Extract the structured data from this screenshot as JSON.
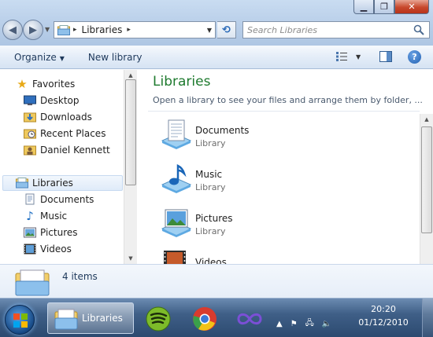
{
  "window": {
    "caption_buttons": [
      "minimize",
      "maximize",
      "close"
    ]
  },
  "address_bar": {
    "path_segments": [
      "Libraries"
    ],
    "refresh_icon": "refresh-icon"
  },
  "search": {
    "placeholder": "Search Libraries",
    "value": ""
  },
  "toolbar": {
    "organize_label": "Organize",
    "new_library_label": "New library",
    "views_icon": "details-view-icon",
    "preview_icon": "preview-pane-icon",
    "help_label": "?"
  },
  "nav": {
    "favorites": {
      "label": "Favorites",
      "items": [
        {
          "label": "Desktop",
          "icon": "desktop-icon"
        },
        {
          "label": "Downloads",
          "icon": "downloads-folder-icon"
        },
        {
          "label": "Recent Places",
          "icon": "recent-places-icon"
        },
        {
          "label": "Daniel Kennett",
          "icon": "user-folder-icon"
        }
      ]
    },
    "libraries": {
      "label": "Libraries",
      "selected": true,
      "items": [
        {
          "label": "Documents",
          "icon": "documents-icon"
        },
        {
          "label": "Music",
          "icon": "music-icon"
        },
        {
          "label": "Pictures",
          "icon": "pictures-icon"
        },
        {
          "label": "Videos",
          "icon": "videos-icon"
        }
      ]
    }
  },
  "content": {
    "title": "Libraries",
    "subtitle": "Open a library to see your files and arrange them by folder, ...",
    "libraries": [
      {
        "name": "Documents",
        "kind": "Library",
        "icon": "documents-library-icon"
      },
      {
        "name": "Music",
        "kind": "Library",
        "icon": "music-library-icon"
      },
      {
        "name": "Pictures",
        "kind": "Library",
        "icon": "pictures-library-icon"
      },
      {
        "name": "Videos",
        "kind": "",
        "icon": "videos-library-icon"
      }
    ]
  },
  "details": {
    "count_label": "4 items"
  },
  "taskbar": {
    "explorer_label": "Libraries",
    "apps": [
      "spotify-icon",
      "chrome-icon",
      "infinity-icon"
    ],
    "clock": {
      "time": "20:20",
      "date": "01/12/2010"
    }
  },
  "colors": {
    "title_green": "#1e7a2e",
    "link_blue": "#1e395b",
    "taskbar": "#3f5f87"
  }
}
